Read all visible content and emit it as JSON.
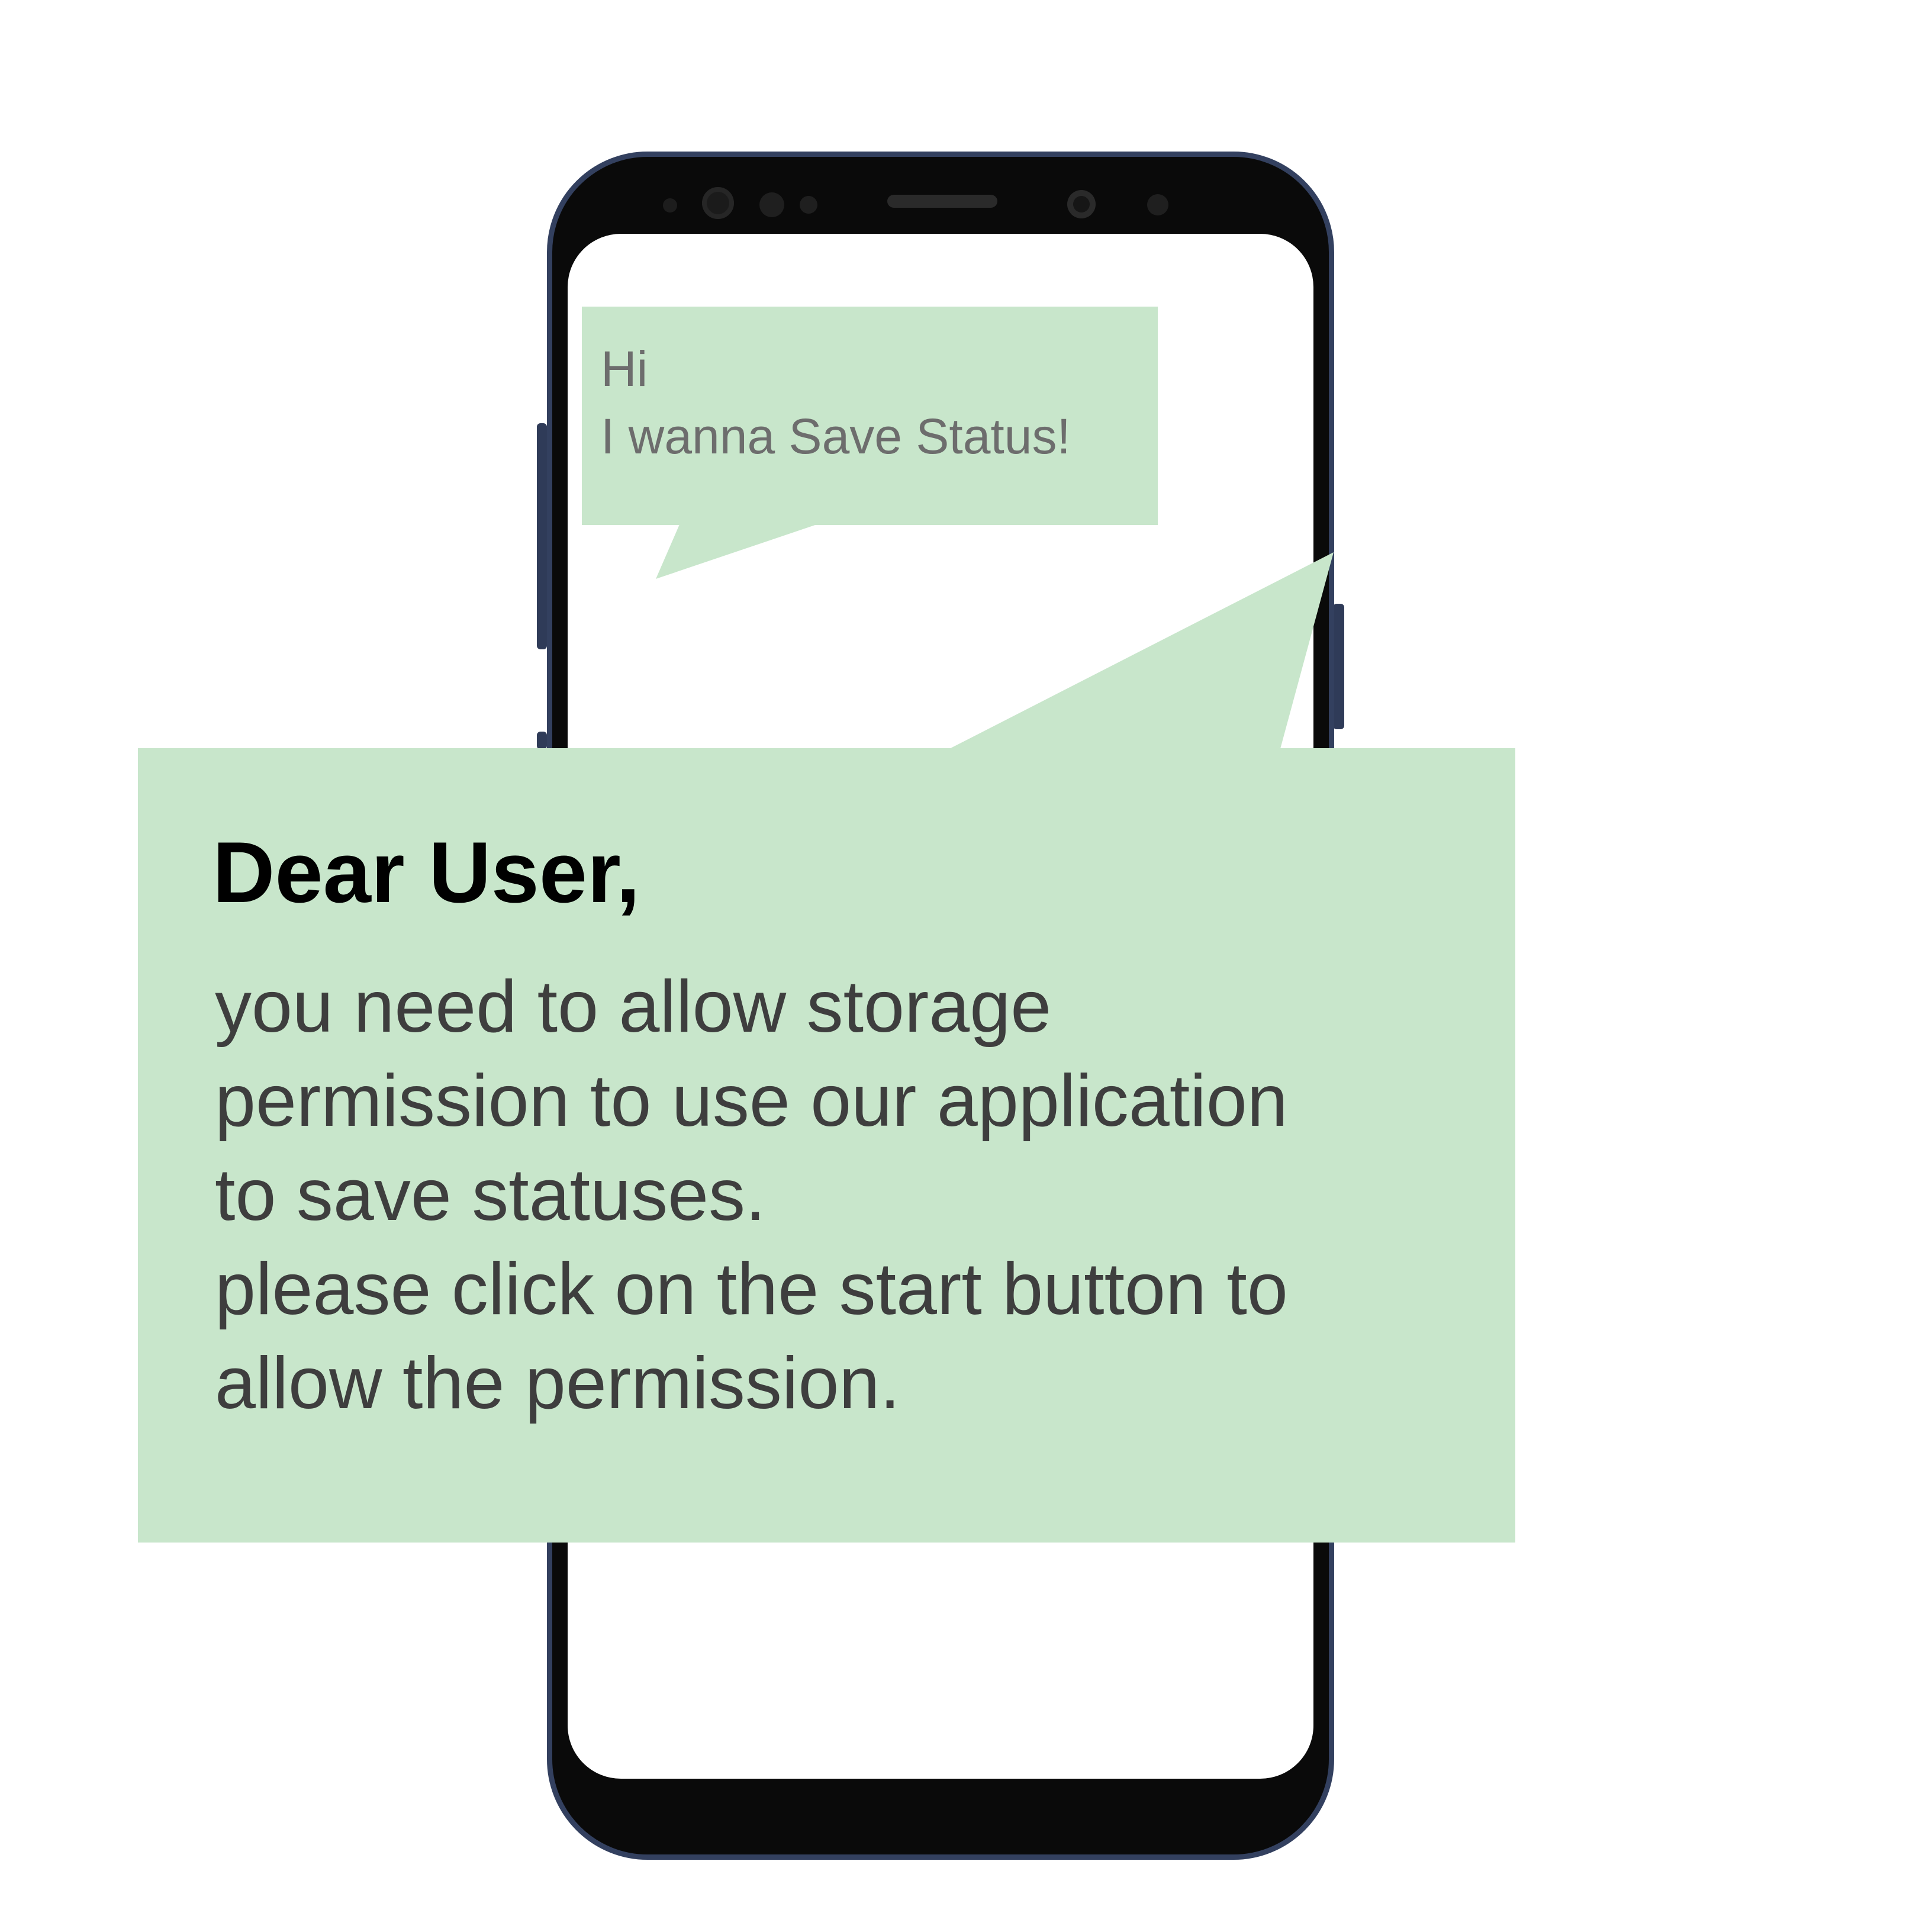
{
  "colors": {
    "bubble_fill": "#c8e6cb",
    "phone_body": "#0a0a0a",
    "phone_frame": "#33405f",
    "small_text": "#6d6d6d",
    "heading_text": "#000000",
    "body_text": "#3e3e3e"
  },
  "user_bubble": {
    "lines": [
      "Hi",
      "I wanna Save Status!"
    ]
  },
  "app_bubble": {
    "greeting": "Dear User,",
    "message_lines": [
      "you need to allow storage",
      "permission to use our application",
      "to save statuses.",
      "please click on the start button to",
      "allow the permission."
    ]
  }
}
